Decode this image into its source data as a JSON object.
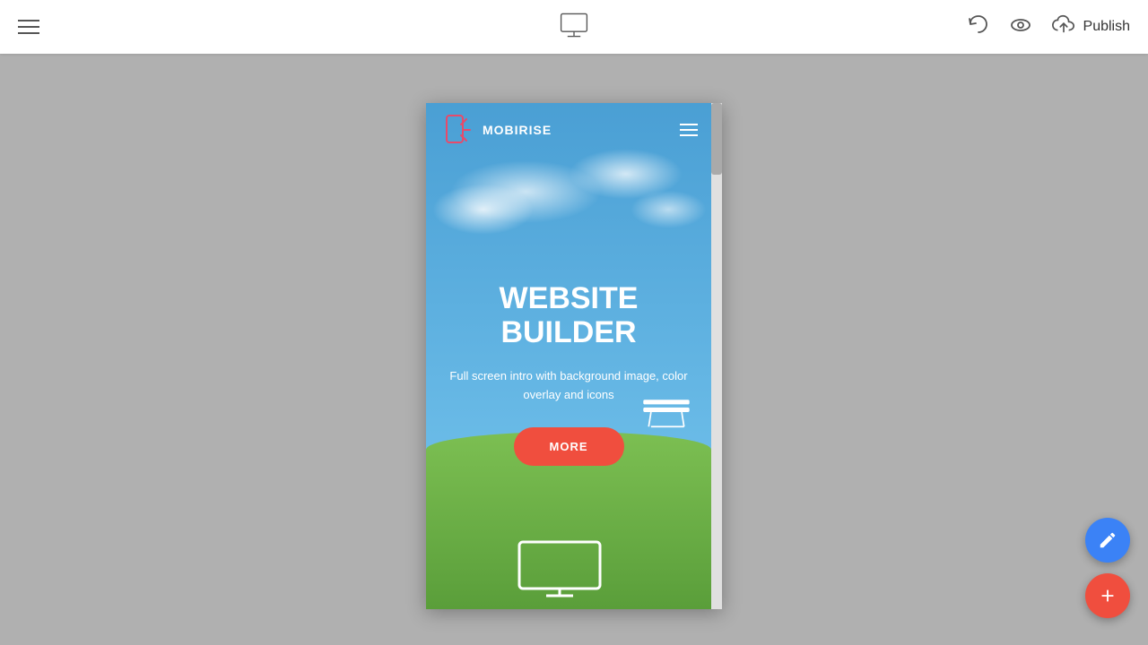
{
  "toolbar": {
    "menu_label": "Menu",
    "undo_label": "Undo",
    "preview_label": "Preview",
    "publish_label": "Publish"
  },
  "preview": {
    "logo_text": "MOBIRISE",
    "hero_title_line1": "WEBSITE",
    "hero_title_line2": "BUILDER",
    "hero_subtitle": "Full screen intro with background image, color overlay and icons",
    "more_button_label": "MORE"
  },
  "fab": {
    "edit_label": "Edit",
    "add_label": "Add"
  }
}
